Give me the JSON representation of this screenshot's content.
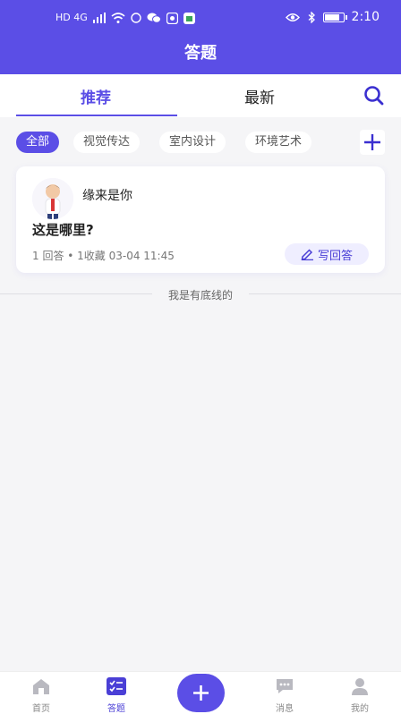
{
  "status_bar": {
    "time": "2:10",
    "network": "HD 4G"
  },
  "header": {
    "title": "答题"
  },
  "tabs": [
    {
      "label": "推荐"
    },
    {
      "label": "最新"
    }
  ],
  "chips": [
    {
      "label": "全部"
    },
    {
      "label": "视觉传达"
    },
    {
      "label": "室内设计"
    },
    {
      "label": "环境艺术"
    }
  ],
  "card": {
    "author": "缘来是你",
    "question": "这是哪里?",
    "meta": "1 回答 • 1收藏   03-04 11:45",
    "answer_button": "写回答"
  },
  "bottom_note": "我是有底线的",
  "nav": [
    {
      "label": "首页"
    },
    {
      "label": "答题"
    },
    {
      "label": "消息"
    },
    {
      "label": "我的"
    }
  ],
  "colors": {
    "accent": "#5b4ee6",
    "accent_light": "#efeeff",
    "background": "#f5f5f7"
  }
}
